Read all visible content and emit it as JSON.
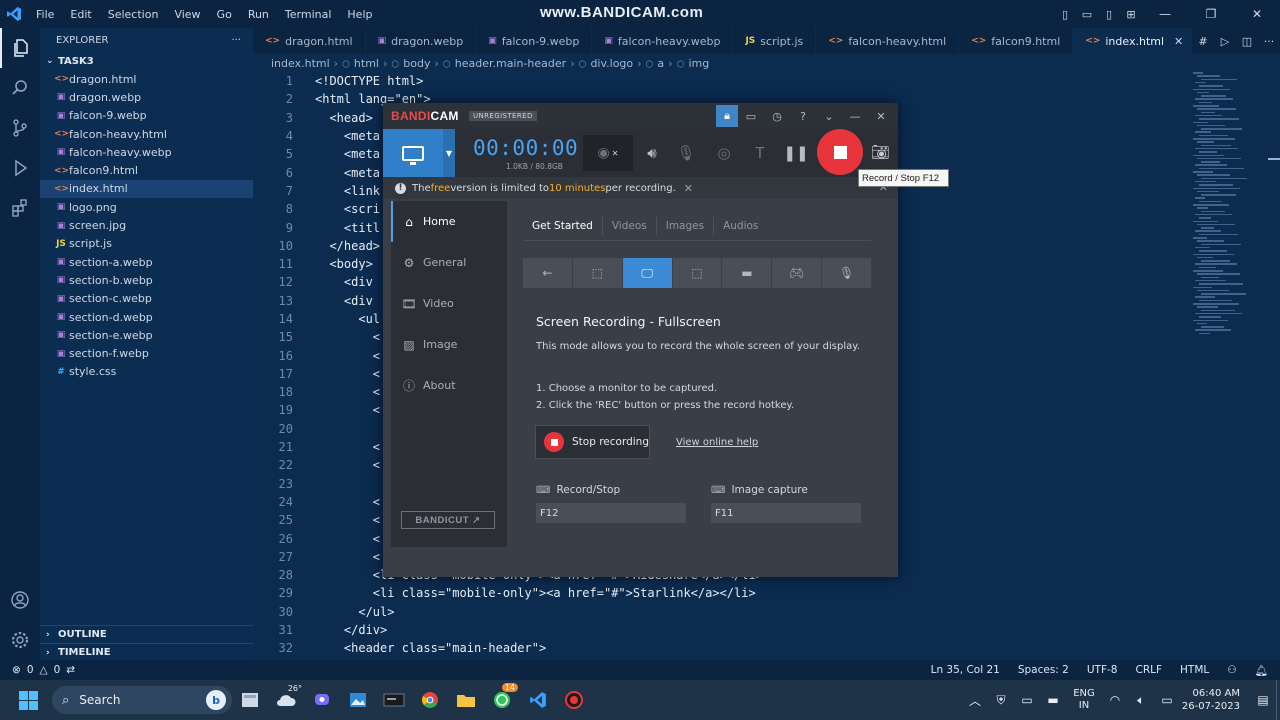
{
  "titlebar": {
    "menu": [
      "File",
      "Edit",
      "Selection",
      "View",
      "Go",
      "Run",
      "Terminal",
      "Help"
    ],
    "watermark": "www.BANDICAM.com"
  },
  "sidebar": {
    "header": "EXPLORER",
    "more": "···",
    "folder": "TASK3",
    "files": [
      {
        "name": "dragon.html",
        "type": "html"
      },
      {
        "name": "dragon.webp",
        "type": "img"
      },
      {
        "name": "falcon-9.webp",
        "type": "img"
      },
      {
        "name": "falcon-heavy.html",
        "type": "html"
      },
      {
        "name": "falcon-heavy.webp",
        "type": "img"
      },
      {
        "name": "falcon9.html",
        "type": "html"
      },
      {
        "name": "index.html",
        "type": "html",
        "active": true
      },
      {
        "name": "logo.png",
        "type": "img"
      },
      {
        "name": "screen.jpg",
        "type": "img"
      },
      {
        "name": "script.js",
        "type": "js"
      },
      {
        "name": "section-a.webp",
        "type": "img"
      },
      {
        "name": "section-b.webp",
        "type": "img"
      },
      {
        "name": "section-c.webp",
        "type": "img"
      },
      {
        "name": "section-d.webp",
        "type": "img"
      },
      {
        "name": "section-e.webp",
        "type": "img"
      },
      {
        "name": "section-f.webp",
        "type": "img"
      },
      {
        "name": "style.css",
        "type": "css"
      }
    ],
    "outline": "OUTLINE",
    "timeline": "TIMELINE"
  },
  "tabs": [
    {
      "label": "dragon.html",
      "type": "html"
    },
    {
      "label": "dragon.webp",
      "type": "img"
    },
    {
      "label": "falcon-9.webp",
      "type": "img"
    },
    {
      "label": "falcon-heavy.webp",
      "type": "img"
    },
    {
      "label": "script.js",
      "type": "js"
    },
    {
      "label": "falcon-heavy.html",
      "type": "html"
    },
    {
      "label": "falcon9.html",
      "type": "html"
    },
    {
      "label": "index.html",
      "type": "html",
      "active": true
    }
  ],
  "breadcrumb": [
    "index.html",
    "html",
    "body",
    "header.main-header",
    "div.logo",
    "a",
    "img"
  ],
  "code": {
    "lines": [
      {
        "n": "1",
        "indent": 0,
        "text": "<!DOCTYPE html>"
      },
      {
        "n": "2",
        "indent": 0,
        "text": "<html lang=\"en\">"
      },
      {
        "n": "3",
        "indent": 1,
        "text": "<head>"
      },
      {
        "n": "4",
        "indent": 2,
        "text": "<meta"
      },
      {
        "n": "5",
        "indent": 2,
        "text": "<meta"
      },
      {
        "n": "6",
        "indent": 2,
        "text": "<meta"
      },
      {
        "n": "7",
        "indent": 2,
        "text": "<link"
      },
      {
        "n": "8",
        "indent": 2,
        "text": "<scri"
      },
      {
        "n": "9",
        "indent": 2,
        "text": "<titl"
      },
      {
        "n": "10",
        "indent": 1,
        "text": "</head>"
      },
      {
        "n": "11",
        "indent": 1,
        "text": "<body>"
      },
      {
        "n": "12",
        "indent": 2,
        "text": "<div"
      },
      {
        "n": "13",
        "indent": 2,
        "text": "<div"
      },
      {
        "n": "14",
        "indent": 3,
        "text": "<ul"
      },
      {
        "n": "15",
        "indent": 4,
        "text": "<"
      },
      {
        "n": "16",
        "indent": 4,
        "text": "<"
      },
      {
        "n": "17",
        "indent": 4,
        "text": "<"
      },
      {
        "n": "18",
        "indent": 4,
        "text": "<"
      },
      {
        "n": "19",
        "indent": 4,
        "text": "<"
      },
      {
        "n": "20",
        "indent": 4,
        "text": ""
      },
      {
        "n": "21",
        "indent": 4,
        "text": "<"
      },
      {
        "n": "22",
        "indent": 4,
        "text": "<"
      },
      {
        "n": "23",
        "indent": 4,
        "text": ""
      },
      {
        "n": "24",
        "indent": 4,
        "text": "<"
      },
      {
        "n": "25",
        "indent": 4,
        "text": "<"
      },
      {
        "n": "26",
        "indent": 4,
        "text": "<"
      },
      {
        "n": "27",
        "indent": 4,
        "text": "<"
      },
      {
        "n": "28",
        "indent": 4,
        "text": "<li class=\"mobile-only\"><a href=\"#\">Rideshare</a></li>"
      },
      {
        "n": "29",
        "indent": 4,
        "text": "<li class=\"mobile-only\"><a href=\"#\">Starlink</a></li>"
      },
      {
        "n": "30",
        "indent": 3,
        "text": "</ul>"
      },
      {
        "n": "31",
        "indent": 2,
        "text": "</div>"
      },
      {
        "n": "32",
        "indent": 2,
        "text": "<header class=\"main-header\">"
      }
    ]
  },
  "statusbar": {
    "errors": "0",
    "warnings": "0",
    "position": "Ln 35, Col 21",
    "spaces": "Spaces: 2",
    "encoding": "UTF-8",
    "eol": "CRLF",
    "language": "HTML"
  },
  "taskbar": {
    "search": "Search",
    "weather_temp": "26°",
    "whatsapp_badge": "14",
    "lang_line1": "ENG",
    "lang_line2": "IN",
    "time": "06:40 AM",
    "date": "26-07-2023"
  },
  "bandicam": {
    "logo_a": "BANDI",
    "logo_b": "CAM",
    "unregistered": "UNREGISTERED",
    "timer": "00:00:00",
    "size": "1.0KB / 80.8GB",
    "notice": {
      "pre": "The ",
      "free": "free",
      "mid": " version is limited to ",
      "limit": "10 minutes",
      "post": " per recording."
    },
    "nav": [
      {
        "label": "Home",
        "icon": "home-icon",
        "active": true
      },
      {
        "label": "General",
        "icon": "gear-icon"
      },
      {
        "label": "Video",
        "icon": "film-icon"
      },
      {
        "label": "Image",
        "icon": "image-icon"
      },
      {
        "label": "About",
        "icon": "info-icon"
      }
    ],
    "bandicut": "BANDICUT",
    "subtabs": [
      "Get Started",
      "Videos",
      "Images",
      "Audios"
    ],
    "heading": "Screen Recording - Fullscreen",
    "description": "This mode allows you to record the whole screen of your display.",
    "step1": "1. Choose a monitor to be captured.",
    "step2": "2. Click the 'REC' button or press the record hotkey.",
    "stop_button": "Stop recording",
    "help_link": "View online help",
    "hotkey_record_label": "Record/Stop",
    "hotkey_record_value": "F12",
    "hotkey_image_label": "Image capture",
    "hotkey_image_value": "F11",
    "tooltip": "Record / Stop   F12"
  }
}
